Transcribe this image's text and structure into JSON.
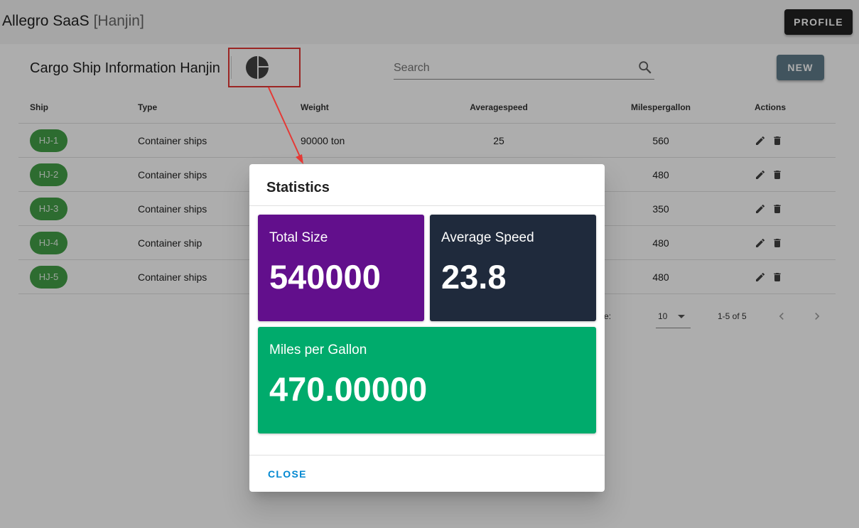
{
  "app": {
    "name": "Allegro SaaS",
    "tenant": "[Hanjin]",
    "profile_label": "PROFILE"
  },
  "page": {
    "title": "Cargo Ship Information Hanjin",
    "search_placeholder": "Search",
    "new_label": "NEW"
  },
  "table": {
    "headers": {
      "ship": "Ship",
      "type": "Type",
      "weight": "Weight",
      "speed": "Averagespeed",
      "mpg": "Milespergallon",
      "actions": "Actions"
    },
    "rows": [
      {
        "ship": "HJ-1",
        "type": "Container ships",
        "weight": "90000 ton",
        "speed": "25",
        "mpg": "560"
      },
      {
        "ship": "HJ-2",
        "type": "Container ships",
        "weight": "",
        "speed": "",
        "mpg": "480"
      },
      {
        "ship": "HJ-3",
        "type": "Container ships",
        "weight": "",
        "speed": "",
        "mpg": "350"
      },
      {
        "ship": "HJ-4",
        "type": "Container ship",
        "weight": "",
        "speed": "",
        "mpg": "480"
      },
      {
        "ship": "HJ-5",
        "type": "Container ships",
        "weight": "",
        "speed": "",
        "mpg": "480"
      }
    ]
  },
  "pagination": {
    "rows_per_page_label": "er page:",
    "rows_per_page": "10",
    "range": "1-5 of 5"
  },
  "dialog": {
    "title": "Statistics",
    "cards": {
      "total_size": {
        "label": "Total Size",
        "value": "540000",
        "color": "#620f8c"
      },
      "avg_speed": {
        "label": "Average Speed",
        "value": "23.8",
        "color": "#1f2a3c"
      },
      "mpg": {
        "label": "Miles per Gallon",
        "value": "470.00000",
        "color": "#00ab6c"
      }
    },
    "close_label": "CLOSE"
  },
  "colors": {
    "chip": "#43a047",
    "accent": "#0288d1",
    "annotation": "#e53935",
    "new_button": "#607d8b"
  },
  "icons": {
    "chart": "pie-chart-icon",
    "search": "search-icon",
    "edit": "pencil-icon",
    "delete": "trash-icon"
  }
}
